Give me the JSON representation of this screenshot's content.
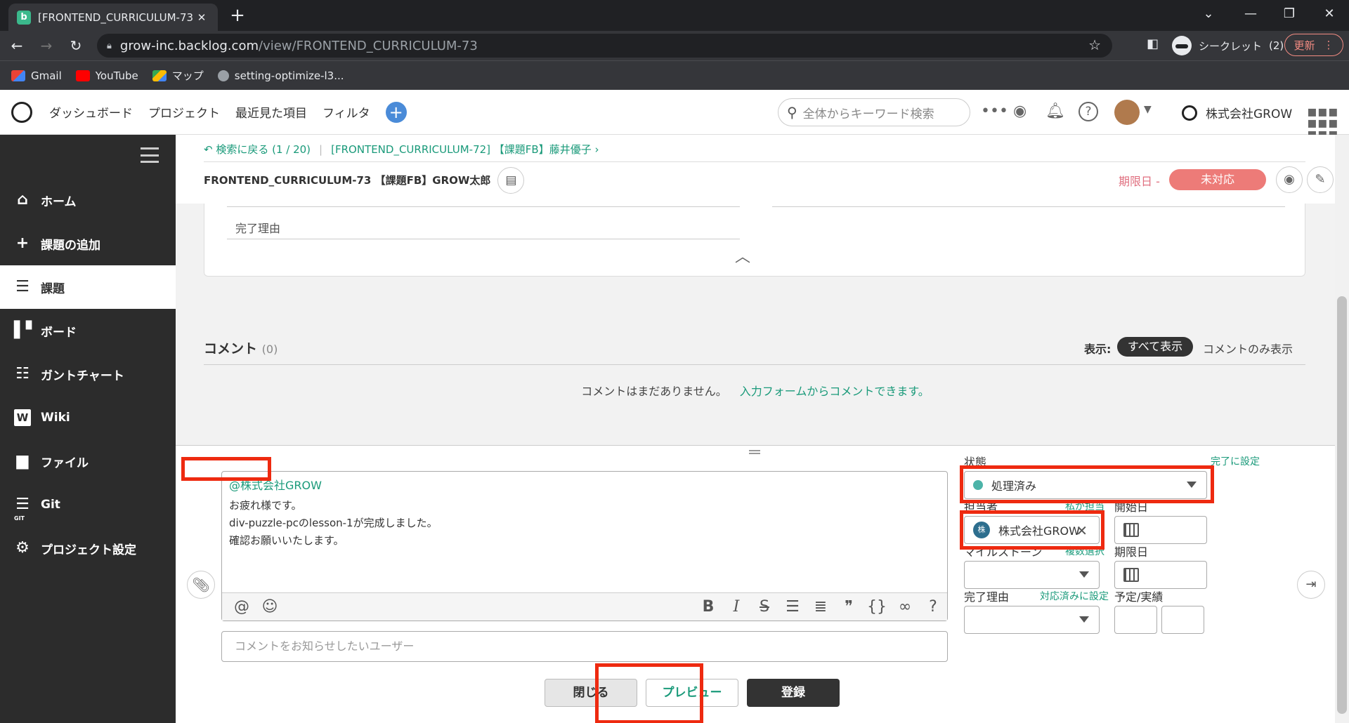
{
  "browser": {
    "tab_title": "[FRONTEND_CURRICULUM-73] [",
    "tab_favicon_letter": "b",
    "url_host": "grow-inc.backlog.com",
    "url_path": "/view/FRONTEND_CURRICULUM-73",
    "incognito_label": "シークレット",
    "incognito_count": "(2)",
    "update_label": "更新",
    "bookmarks": [
      "Gmail",
      "YouTube",
      "マップ",
      "setting-optimize-l3..."
    ]
  },
  "header": {
    "nav": [
      "ダッシュボード",
      "プロジェクト",
      "最近見た項目",
      "フィルタ"
    ],
    "search_placeholder": "全体からキーワード検索",
    "company": "株式会社GROW"
  },
  "sidebar": {
    "items": [
      {
        "label": "ホーム",
        "icon": "home-icon"
      },
      {
        "label": "課題の追加",
        "icon": "plus-icon"
      },
      {
        "label": "課題",
        "icon": "list-icon"
      },
      {
        "label": "ボード",
        "icon": "board-icon"
      },
      {
        "label": "ガントチャート",
        "icon": "gantt-icon"
      },
      {
        "label": "Wiki",
        "icon": "wiki-icon"
      },
      {
        "label": "ファイル",
        "icon": "file-icon"
      },
      {
        "label": "Git",
        "icon": "git-icon"
      },
      {
        "label": "プロジェクト設定",
        "icon": "gear-icon"
      }
    ],
    "active_index": 2,
    "git_sublabel": "GIT"
  },
  "breadcrumb": {
    "back": "検索に戻る (1 / 20)",
    "next": "[FRONTEND_CURRICULUM-72] 【課題FB】藤井優子"
  },
  "issue": {
    "key_title": "FRONTEND_CURRICULUM-73 【課題FB】GROW太郎",
    "due_label": "期限日 -",
    "status": "未対応"
  },
  "details": {
    "resolution_label": "完了理由"
  },
  "comments": {
    "title": "コメント",
    "count": "(0)",
    "display_label": "表示:",
    "show_all": "すべて表示",
    "comments_only": "コメントのみ表示",
    "empty_text": "コメントはまだありません。",
    "empty_link": "入力フォームからコメントできます。"
  },
  "form": {
    "mention": "@株式会社GROW",
    "body_lines": [
      "お疲れ様です。",
      "div-puzzle-pcのlesson-1が完成しました。",
      "確認お願いいたします。"
    ],
    "notify_placeholder": "コメントをお知らせしたいユーザー",
    "close_label": "閉じる",
    "preview_label": "プレビュー",
    "submit_label": "登録",
    "status_label": "状態",
    "status_link": "完了に設定",
    "status_value": "処理済み",
    "status_color": "#4cb3a8",
    "assignee_label": "担当者",
    "assignee_link": "私が担当",
    "assignee_value": "株式会社GROW",
    "assignee_avatar": "株",
    "start_date_label": "開始日",
    "milestone_label": "マイルストーン",
    "milestone_link": "複数選択",
    "due_date_label": "期限日",
    "resolution_label": "完了理由",
    "resolution_link": "対応済みに設定",
    "estimate_label": "予定/実績"
  },
  "colors": {
    "accent": "#1a9a7a",
    "highlight": "#ee2a10",
    "status_pill": "#ed7b78"
  }
}
